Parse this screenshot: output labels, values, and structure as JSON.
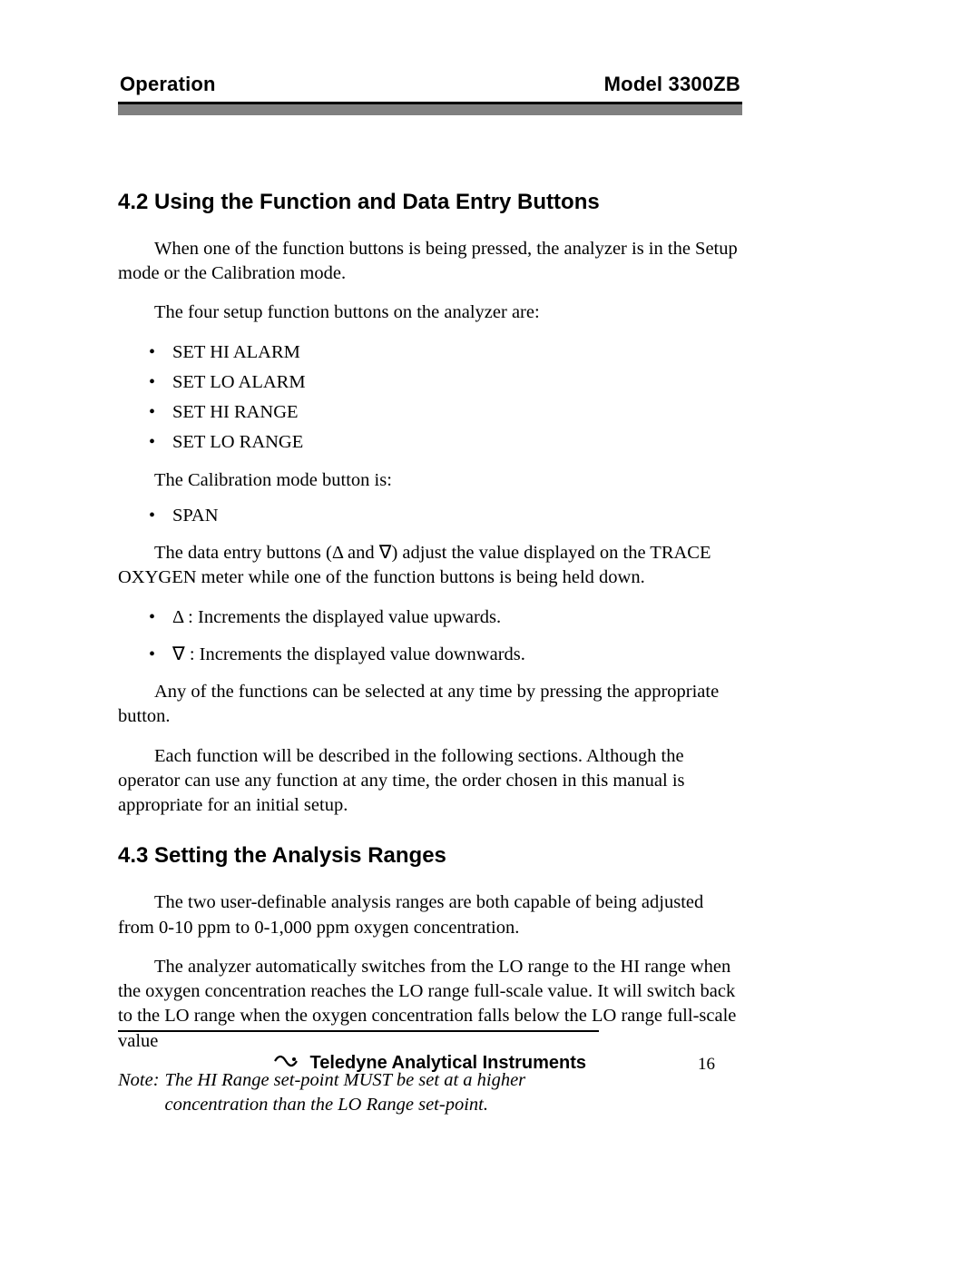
{
  "header": {
    "left": "Operation",
    "right": "Model 3300ZB"
  },
  "section42": {
    "heading": "4.2 Using the Function and Data Entry Buttons",
    "p1": "When one of the function buttons is being pressed, the analyzer is in the Setup mode or the Calibration mode.",
    "p2": "The four setup function buttons on the analyzer are:",
    "setup_list": [
      "SET HI ALARM",
      "SET LO ALARM",
      "SET HI RANGE",
      "SET LO RANGE"
    ],
    "cal_intro": "The Calibration mode button is:",
    "cal_list": [
      "SPAN"
    ],
    "p3": "The data entry buttons (Δ and ∇) adjust the value displayed on the TRACE OXYGEN meter while one of the function buttons is being held down.",
    "sym_list": [
      "Δ :  Increments the displayed value upwards.",
      "∇ :  Increments the displayed value downwards."
    ],
    "p4": "Any of the functions can be selected at any time by pressing the appropriate button.",
    "p5": "Each function will be described in the following sections. Although the operator can use any function at any time, the order chosen in this manual is appropriate for an initial setup."
  },
  "section43": {
    "heading": "4.3 Setting the Analysis Ranges",
    "p1": "The two user-definable analysis ranges are both capable of being adjusted from 0-10 ppm to 0-1,000 ppm oxygen concentration.",
    "p2": "The analyzer automatically switches from the LO range to the HI range when the oxygen concentration reaches the LO range full-scale value.  It will switch back to the LO range when the oxygen concentration falls below the LO range full-scale value",
    "note_label": "Note:  ",
    "note_body": "The HI Range set-point MUST be set at a higher concentration than the LO Range set-point."
  },
  "footer": {
    "company": "Teledyne Analytical Instruments",
    "page": "16"
  }
}
